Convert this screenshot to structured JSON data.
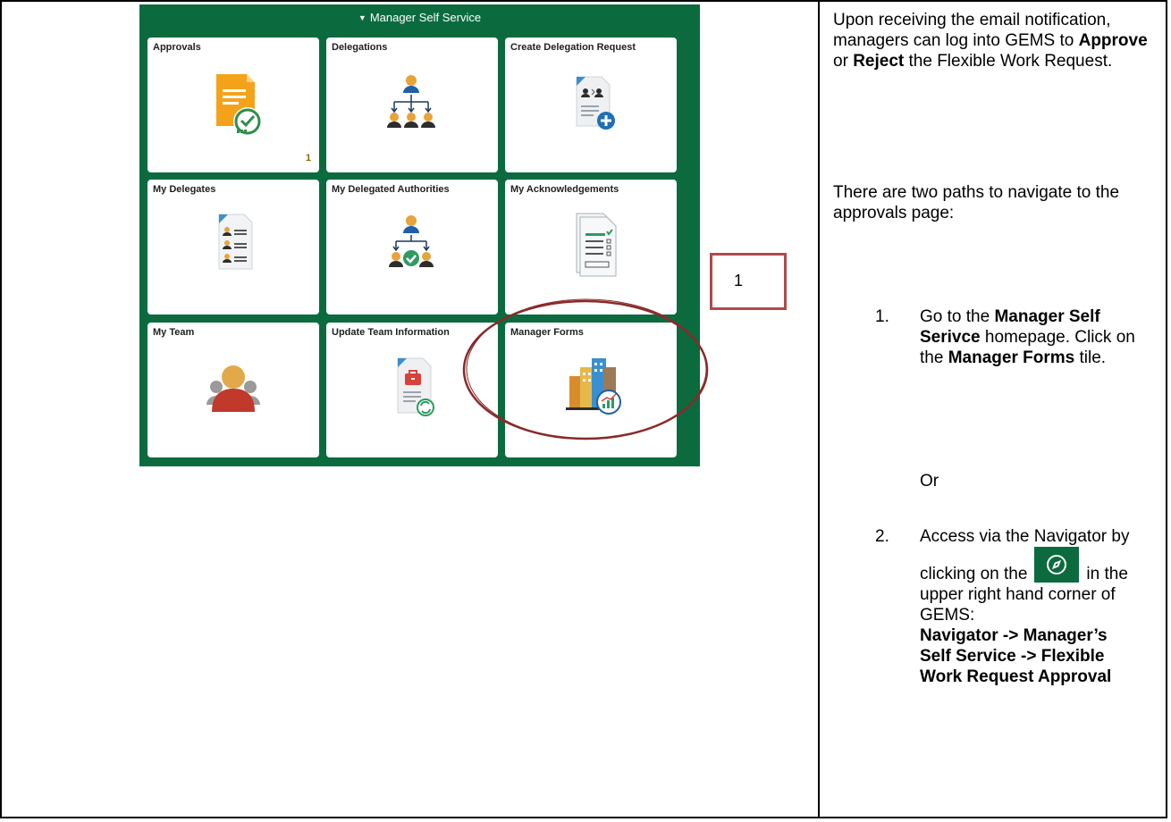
{
  "panel": {
    "header_title": "Manager Self Service",
    "tiles": [
      {
        "title": "Approvals",
        "icon": "approvals-document-check-icon",
        "badge": "1"
      },
      {
        "title": "Delegations",
        "icon": "delegation-hierarchy-icon"
      },
      {
        "title": "Create Delegation Request",
        "icon": "create-delegation-document-plus-icon"
      },
      {
        "title": "My Delegates",
        "icon": "delegates-list-document-icon"
      },
      {
        "title": "My Delegated Authorities",
        "icon": "delegated-authorities-hierarchy-check-icon"
      },
      {
        "title": "My Acknowledgements",
        "icon": "acknowledgements-checklist-icon"
      },
      {
        "title": "My Team",
        "icon": "team-people-icon"
      },
      {
        "title": "Update Team Information",
        "icon": "update-team-briefcase-refresh-icon"
      },
      {
        "title": "Manager Forms",
        "icon": "manager-forms-buildings-chart-icon"
      }
    ]
  },
  "callout": {
    "number": "1"
  },
  "instructions": {
    "intro_1": "Upon receiving the email notification, managers can log into GEMS to ",
    "approve": "Approve",
    "or_word": " or ",
    "reject": "Reject",
    "intro_2": " the Flexible Work Request.",
    "paths_text": "There are two paths to navigate to the approvals page:",
    "step1_num": "1.",
    "step1_a": "Go to the ",
    "step1_b": "Manager Self Serivce",
    "step1_c": " homepage. Click on the ",
    "step1_d": "Manager Forms",
    "step1_e": " tile.",
    "or_sep": "Or",
    "step2_num": "2.",
    "step2_a": "Access via the Navigator by clicking on the",
    "step2_b": "in the upper right hand corner of GEMS:",
    "step2_c": "Navigator -> Manager’s Self Service -> Flexible Work Request Approval"
  },
  "colors": {
    "panel_green": "#0b6b3f",
    "callout_red": "#b04a4a"
  }
}
